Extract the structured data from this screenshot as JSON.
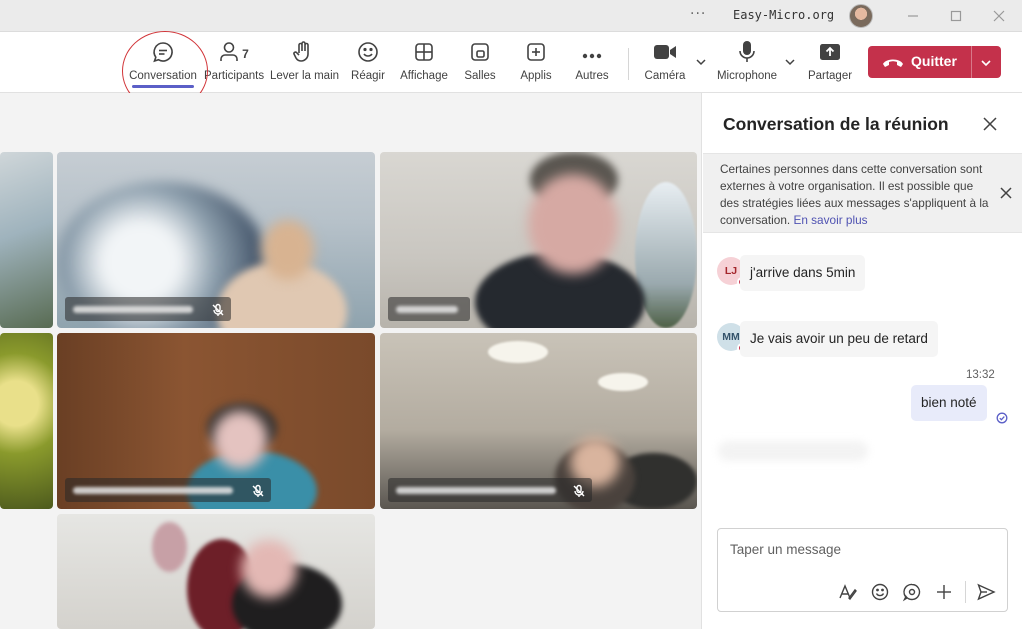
{
  "window": {
    "title": "Easy-Micro.org",
    "more_glyph": "···"
  },
  "toolbar": {
    "items": [
      {
        "label": "Conversation",
        "icon": "chat-icon"
      },
      {
        "label": "Participants",
        "icon": "people-icon",
        "count": "7"
      },
      {
        "label": "Lever la main",
        "icon": "raise-hand-icon"
      },
      {
        "label": "Réagir",
        "icon": "emoji-icon"
      },
      {
        "label": "Affichage",
        "icon": "grid-icon"
      },
      {
        "label": "Salles",
        "icon": "rooms-icon"
      },
      {
        "label": "Applis",
        "icon": "add-app-icon"
      },
      {
        "label": "Autres",
        "icon": "more-icon"
      },
      {
        "label": "Caméra",
        "icon": "camera-icon"
      },
      {
        "label": "Microphone",
        "icon": "microphone-icon"
      },
      {
        "label": "Partager",
        "icon": "share-icon"
      }
    ],
    "leave_label": "Quitter"
  },
  "colors": {
    "accent": "#5b5fc7",
    "leave": "#c4314b",
    "annotation": "#d13438"
  },
  "chat": {
    "title": "Conversation de la réunion",
    "banner_text": "Certaines personnes dans cette conversation sont externes à votre organisation. Il est possible que des stratégies liées aux messages s'appliquent à la conversation.",
    "banner_link": "En savoir plus",
    "messages": [
      {
        "initials": "LJ",
        "text": "j'arrive dans 5min"
      },
      {
        "initials": "MM",
        "text": "Je vais avoir un peu de retard"
      }
    ],
    "own_message": {
      "time": "13:32",
      "text": "bien noté"
    },
    "composer_placeholder": "Taper un message"
  }
}
